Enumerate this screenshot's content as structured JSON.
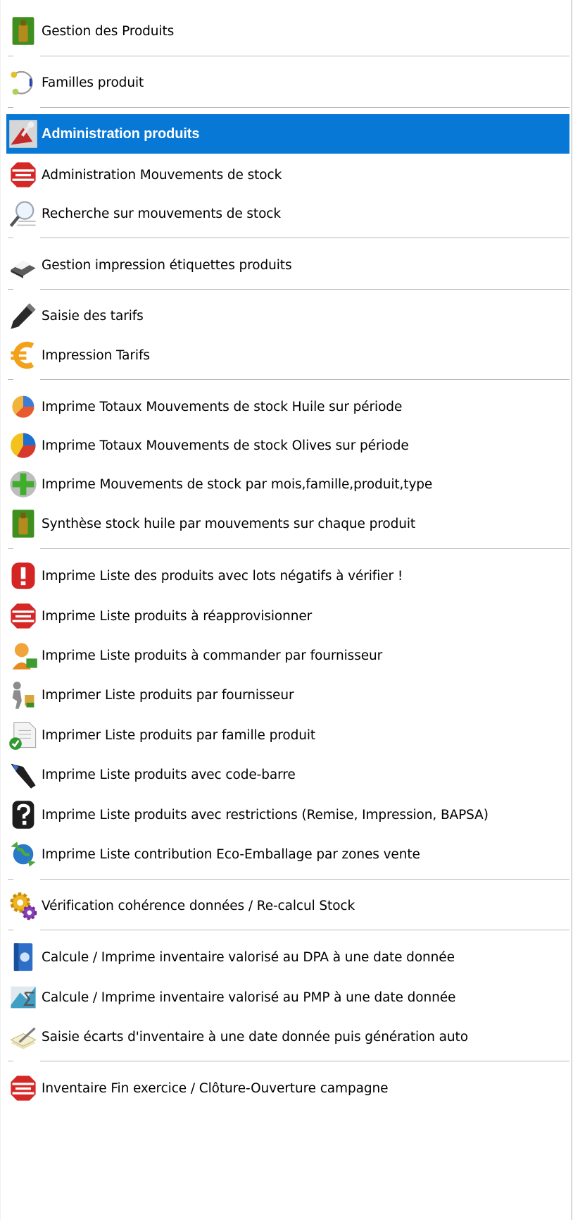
{
  "menu": {
    "items": [
      {
        "label": "Gestion des Produits",
        "icon": "oil-bottle-icon"
      },
      {
        "label": "Familles produit",
        "icon": "product-family-icon"
      },
      {
        "label": "Administration produits",
        "icon": "admin-tools-icon",
        "selected": true
      },
      {
        "label": "Administration Mouvements de stock",
        "icon": "stock-out-icon"
      },
      {
        "label": "Recherche sur mouvements de stock",
        "icon": "magnifier-icon"
      },
      {
        "label": "Gestion impression étiquettes produits",
        "icon": "label-printer-icon"
      },
      {
        "label": "Saisie des tarifs",
        "icon": "pen-icon"
      },
      {
        "label": "Impression Tarifs",
        "icon": "euro-icon"
      },
      {
        "label": "Imprime Totaux Mouvements de stock Huile sur période",
        "icon": "pie-chart-icon"
      },
      {
        "label": "Imprime Totaux Mouvements de stock Olives sur période",
        "icon": "pie-chart-3d-icon"
      },
      {
        "label": "Imprime Mouvements de stock par mois,famille,produit,type",
        "icon": "add-green-icon"
      },
      {
        "label": "Synthèse stock huile par mouvements sur chaque produit",
        "icon": "oil-bottle-icon"
      },
      {
        "label": "Imprime Liste des produits avec lots négatifs à vérifier !",
        "icon": "warning-icon"
      },
      {
        "label": "Imprime Liste produits à réapprovisionner",
        "icon": "stock-out-icon"
      },
      {
        "label": "Imprime Liste produits à commander par fournisseur",
        "icon": "supplier-person-icon"
      },
      {
        "label": "Imprimer Liste produits par fournisseur",
        "icon": "delivery-man-icon"
      },
      {
        "label": "Imprimer Liste produits par famille produit",
        "icon": "document-check-icon"
      },
      {
        "label": "Imprime Liste produits avec code-barre",
        "icon": "barcode-scanner-icon"
      },
      {
        "label": "Imprime Liste produits avec restrictions (Remise, Impression, BAPSA)",
        "icon": "question-mark-icon"
      },
      {
        "label": "Imprime Liste contribution Eco-Emballage par zones vente",
        "icon": "recycle-globe-icon"
      },
      {
        "label": "Vérification cohérence données / Re-calcul Stock",
        "icon": "gears-icon"
      },
      {
        "label": "Calcule / Imprime inventaire valorisé au DPA  à une date donnée",
        "icon": "blue-book-icon"
      },
      {
        "label": "Calcule / Imprime inventaire valorisé au PMP à une date donnée",
        "icon": "sigma-icon"
      },
      {
        "label": "Saisie écarts d'inventaire à une date donnée puis génération auto",
        "icon": "edit-notes-icon"
      },
      {
        "label": "Inventaire Fin exercice / Clôture-Ouverture campagne",
        "icon": "stock-out-icon"
      }
    ]
  },
  "colors": {
    "selection": "#0878d7",
    "separator": "#b9b9b9"
  }
}
